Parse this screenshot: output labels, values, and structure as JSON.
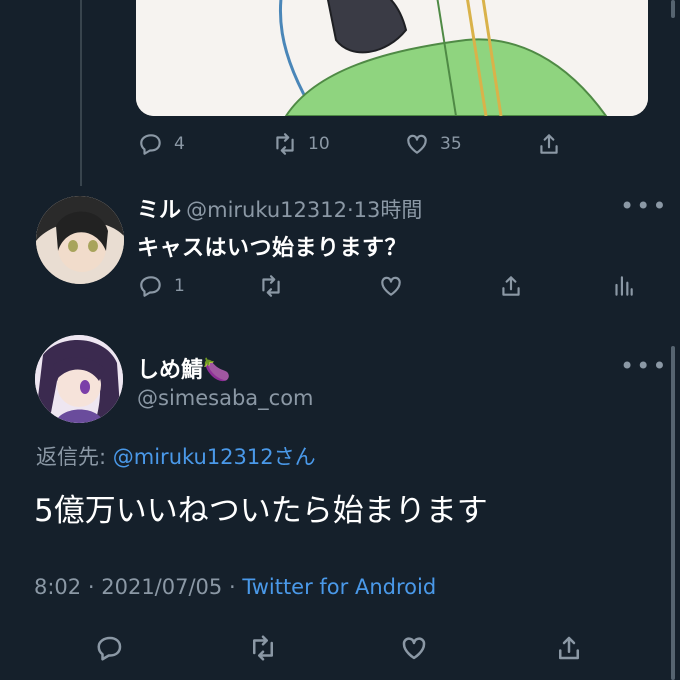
{
  "tweet1": {
    "actions": {
      "replies": "4",
      "retweets": "10",
      "likes": "35"
    }
  },
  "reply1": {
    "name": "ミル",
    "handle": "@miruku12312",
    "separator": "·",
    "time": "13時間",
    "text": "キャスはいつ始まります？",
    "actions": {
      "replies": "1"
    },
    "more": "•••"
  },
  "main_tweet": {
    "name": "しめ鯖🍆",
    "handle": "@simesaba_com",
    "more": "•••",
    "reply_label": "返信先:",
    "reply_to": "@miruku12312さん",
    "text": "5億万いいねついたら始まります",
    "time": "8:02",
    "date": "2021/07/05",
    "separator": "·",
    "client": "Twitter for Android"
  },
  "colors": {
    "background": "#15202b",
    "secondary_text": "#8b98a5",
    "link": "#4a99e9",
    "divider": "#38444d"
  }
}
